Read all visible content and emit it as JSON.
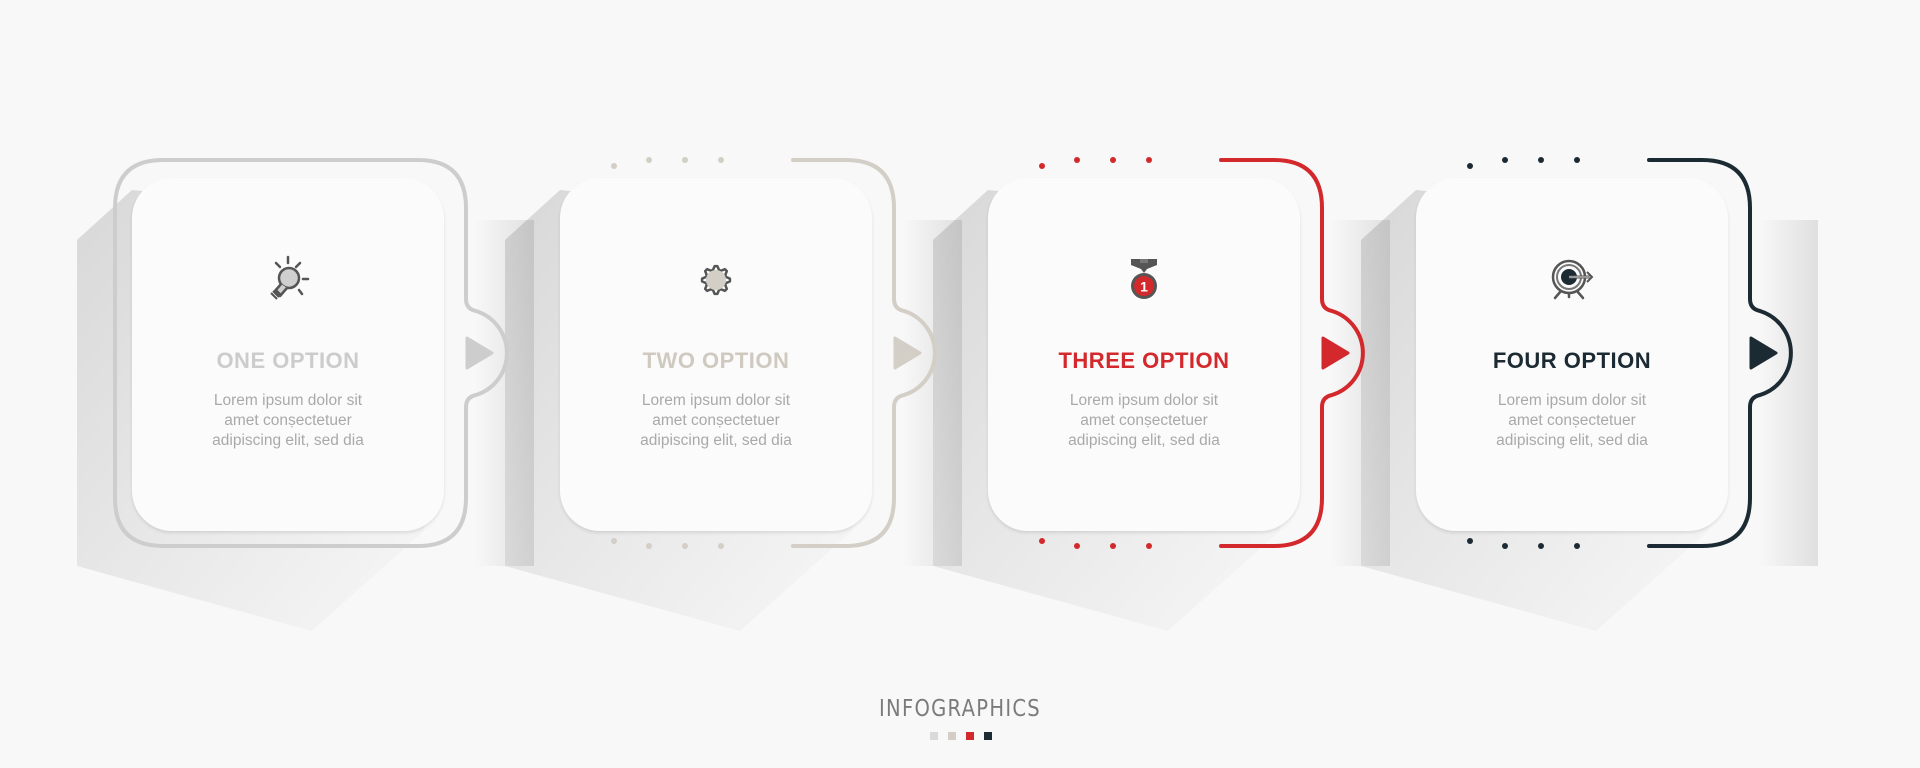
{
  "footer": {
    "title": "INFOGRAPHICS",
    "swatches": [
      "#d9d9d9",
      "#d2cdc5",
      "#d3282c",
      "#1c2b33"
    ]
  },
  "steps": [
    {
      "title": "ONE OPTION",
      "icon": "lightbulb-icon",
      "body": [
        "Lorem ipsum dolor sit",
        "amet  conṣectetuer",
        "adipiscing elit, sed dia"
      ],
      "accent": "#cdcdcd",
      "title_color": "#cccccc",
      "border_style": "solid"
    },
    {
      "title": "TWO OPTION",
      "icon": "gear-icon",
      "body": [
        "Lorem ipsum dolor sit",
        "amet  conṣectetuer",
        "adipiscing elit, sed dia"
      ],
      "accent": "#d3cec6",
      "title_color": "#cfc9c0",
      "border_style": "dotted"
    },
    {
      "title": "THREE OPTION",
      "icon": "medal-icon",
      "body": [
        "Lorem ipsum dolor sit",
        "amet  conṣectetuer",
        "adipiscing elit, sed dia"
      ],
      "accent": "#d3282c",
      "title_color": "#d3282c",
      "border_style": "dotted"
    },
    {
      "title": "FOUR OPTION",
      "icon": "target-icon",
      "body": [
        "Lorem ipsum dolor sit",
        "amet  conṣectetuer",
        "adipiscing elit, sed dia"
      ],
      "accent": "#1c2b33",
      "title_color": "#1c2b33",
      "border_style": "dotted"
    }
  ]
}
